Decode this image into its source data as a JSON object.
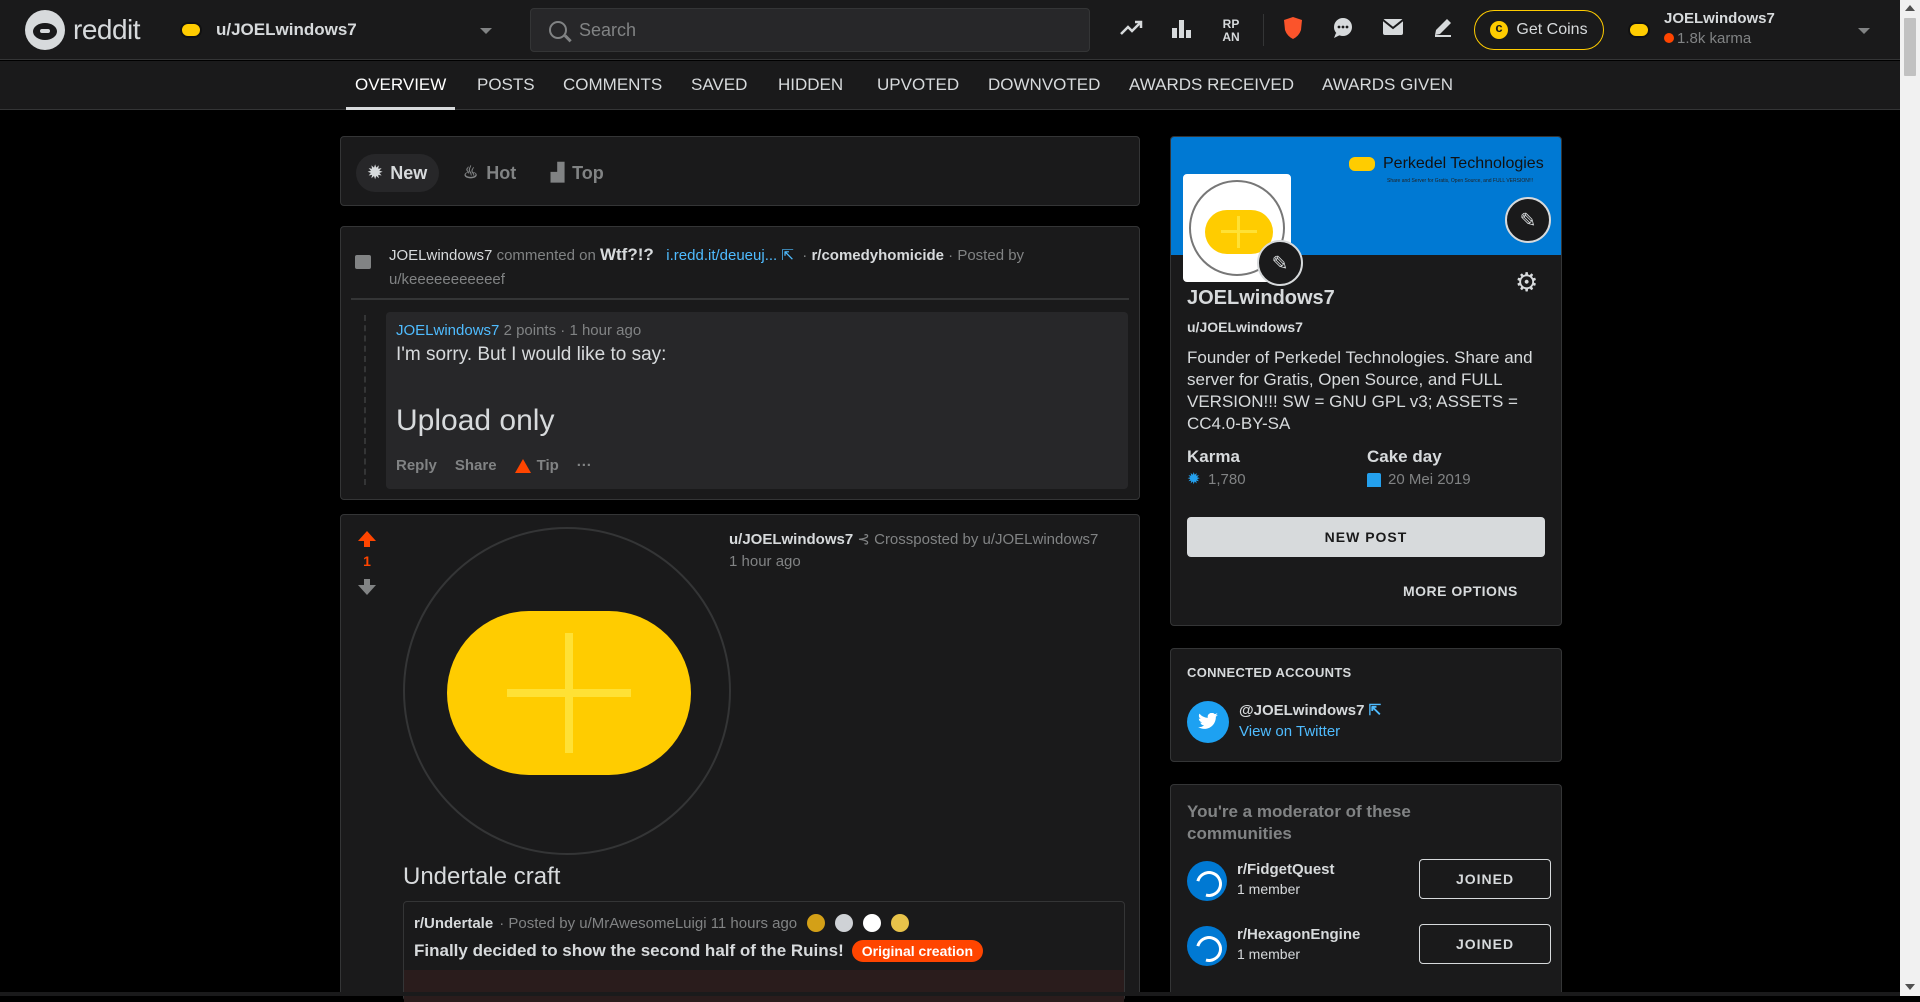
{
  "header": {
    "logo_text": "reddit",
    "user_switch_label": "u/JOELwindows7",
    "search_placeholder": "Search",
    "icons": [
      "popular-icon",
      "stats-icon",
      "rpan-icon",
      "brave-shield-icon",
      "chat-icon",
      "mail-icon",
      "create-post-icon"
    ],
    "get_coins_label": "Get Coins",
    "username": "JOELwindows7",
    "karma": "1.8k karma",
    "accent_color": "#ffcc00"
  },
  "tabs": [
    "OVERVIEW",
    "POSTS",
    "COMMENTS",
    "SAVED",
    "HIDDEN",
    "UPVOTED",
    "DOWNVOTED",
    "AWARDS RECEIVED",
    "AWARDS GIVEN"
  ],
  "sort": {
    "new": "New",
    "hot": "Hot",
    "top": "Top"
  },
  "comment_card": {
    "author": "JOELwindows7",
    "commented_on": "commented on",
    "post_title": "Wtf?!?",
    "link": "i.redd.it/deueuj...",
    "subreddit": "r/comedyhomicide",
    "posted_by_prefix": "· Posted by",
    "posted_by": "u/keeeeeeeeeeef",
    "comment_author": "JOELwindows7",
    "points": "2 points",
    "time": "· 1 hour ago",
    "text_line1": "I'm sorry. But I would like to say:",
    "text_big": "Upload only",
    "actions": {
      "reply": "Reply",
      "share": "Share",
      "tip": "Tip",
      "more": "···"
    }
  },
  "post_card": {
    "vote_count": "1",
    "author": "u/JOELwindows7",
    "crosspost_text": "Crossposted by u/JOELwindows7",
    "time": "1 hour ago",
    "title": "Undertale craft",
    "xpost_subreddit": "r/Undertale",
    "xpost_meta": "· Posted by u/MrAwesomeLuigi 11 hours ago",
    "xpost_title": "Finally decided to show the second half of the Ruins!",
    "flair": "Original creation"
  },
  "profile": {
    "banner_brand": "Perkedel Technologies",
    "banner_sub": "Share and Server for Gratis, Open Source, and FULL VERSION!!!",
    "name": "JOELwindows7",
    "handle": "u/JOELwindows7",
    "bio": "Founder of Perkedel Technologies. Share and server for Gratis, Open Source, and FULL VERSION!!! SW = GNU GPL v3; ASSETS = CC4.0-BY-SA",
    "karma_label": "Karma",
    "karma_value": "1,780",
    "cakeday_label": "Cake day",
    "cakeday_value": "20 Mei 2019",
    "new_post": "NEW POST",
    "more_options": "MORE OPTIONS"
  },
  "connected": {
    "heading": "CONNECTED ACCOUNTS",
    "handle": "@JOELwindows7",
    "link": "View on Twitter"
  },
  "moderation": {
    "heading": "You're a moderator of these communities",
    "communities": [
      {
        "name": "r/FidgetQuest",
        "members": "1 member",
        "button": "JOINED"
      },
      {
        "name": "r/HexagonEngine",
        "members": "1 member",
        "button": "JOINED"
      }
    ]
  }
}
